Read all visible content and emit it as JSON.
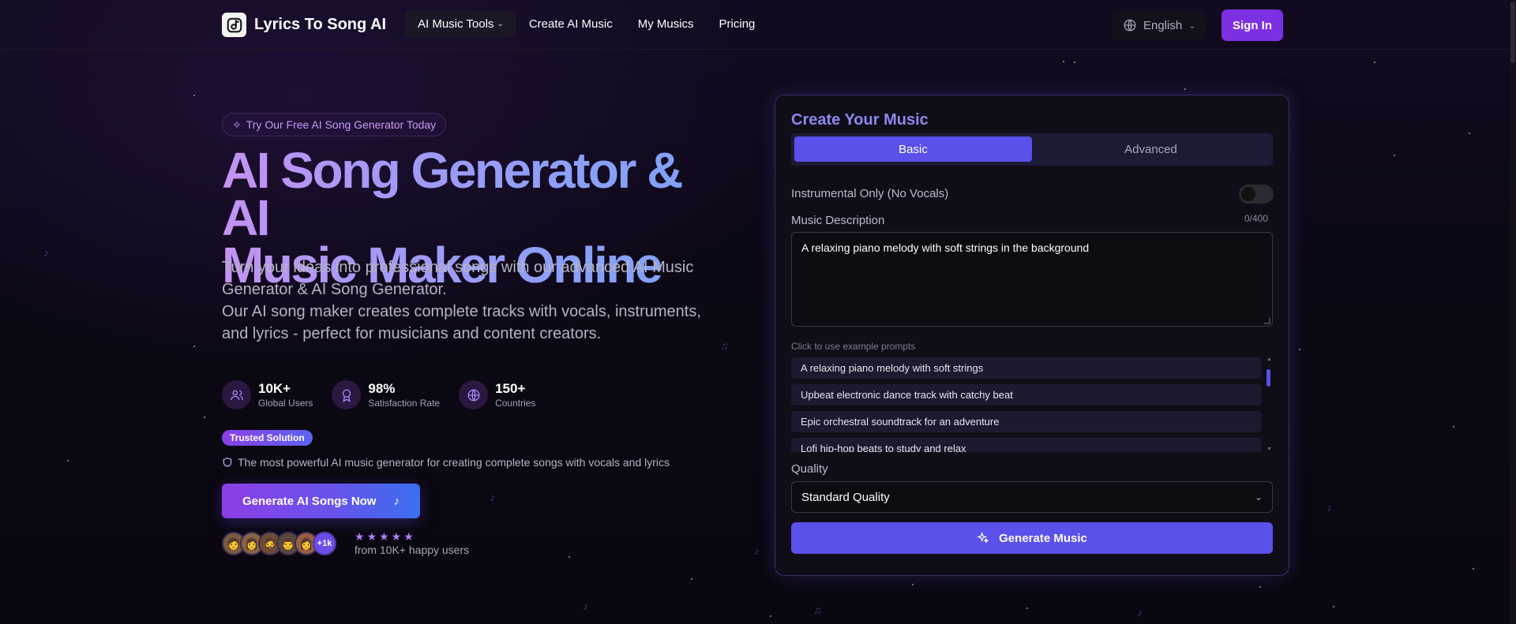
{
  "header": {
    "brand": "Lyrics To Song AI",
    "nav": [
      {
        "label": "AI Music Tools",
        "has_dropdown": true
      },
      {
        "label": "Create AI Music"
      },
      {
        "label": "My Musics"
      },
      {
        "label": "Pricing"
      }
    ],
    "language": "English",
    "signin_label": "Sign In"
  },
  "hero": {
    "badge": "Try Our Free AI Song Generator Today",
    "title_line1": "AI Song Generator & AI",
    "title_line2": "Music Maker Online",
    "desc_line1": "Turn your ideas into professional songs with our advanced AI Music Generator & AI Song Generator.",
    "desc_line2": "Our AI song maker creates complete tracks with vocals, instruments, and lyrics - perfect for musicians and content creators.",
    "stats": [
      {
        "value": "10K+",
        "label": "Global Users",
        "icon": "users-icon"
      },
      {
        "value": "98%",
        "label": "Satisfaction Rate",
        "icon": "award-icon"
      },
      {
        "value": "150+",
        "label": "Countries",
        "icon": "globe-icon"
      }
    ],
    "trusted_badge": "Trusted Solution",
    "trusted_text": "The most powerful AI music generator for creating complete songs with vocals and lyrics",
    "cta_label": "Generate AI Songs Now",
    "avatars_more": "+1k",
    "rating_text": "from 10K+ happy users",
    "rating_stars": 5
  },
  "panel": {
    "title": "Create Your Music",
    "tabs": [
      {
        "label": "Basic",
        "active": true
      },
      {
        "label": "Advanced",
        "active": false
      }
    ],
    "instrumental_label": "Instrumental Only (No Vocals)",
    "instrumental_on": false,
    "description_label": "Music Description",
    "description_counter": "0/400",
    "description_value": "A relaxing piano melody with soft strings in the background",
    "examples_hint": "Click to use example prompts",
    "examples": [
      "A relaxing piano melody with soft strings",
      "Upbeat electronic dance track with catchy beat",
      "Epic orchestral soundtrack for an adventure",
      "Lofi hip-hop beats to study and relax"
    ],
    "quality_label": "Quality",
    "quality_value": "Standard Quality",
    "generate_label": "Generate Music"
  },
  "colors": {
    "accent": "#5a50ea",
    "brand_purple": "#7c2fe3",
    "background": "#0c0815"
  }
}
